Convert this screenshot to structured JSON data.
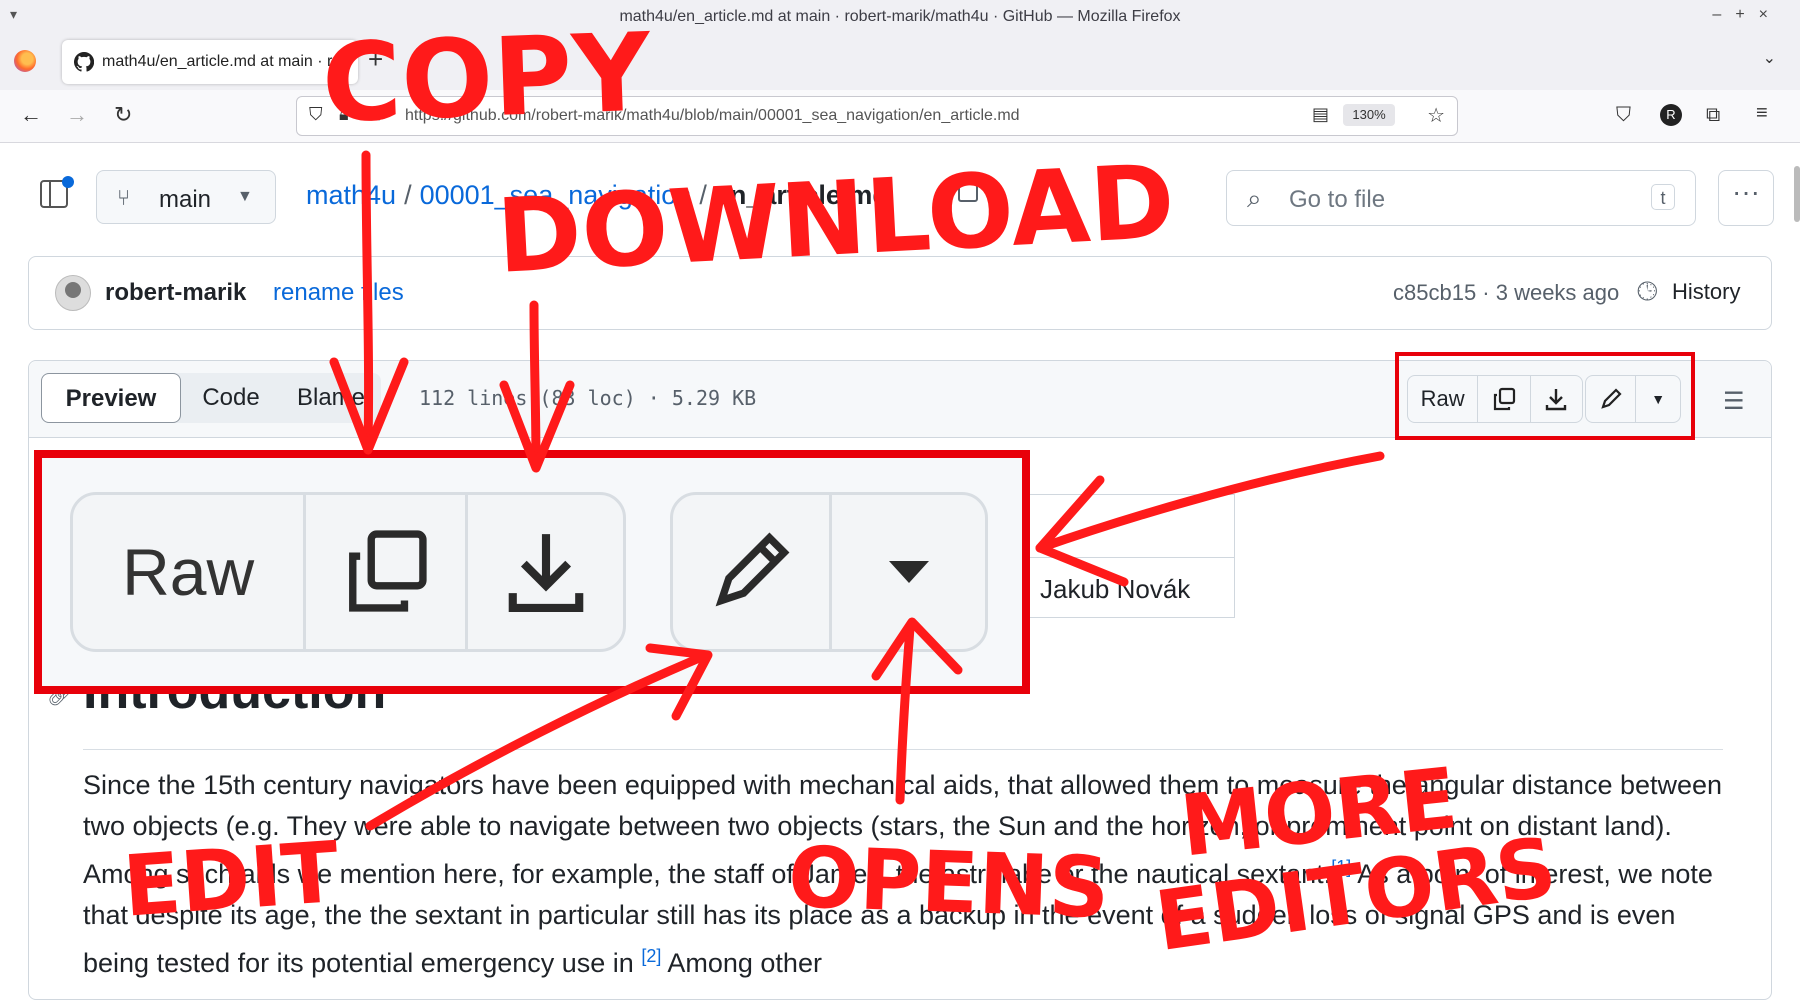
{
  "window": {
    "title": "math4u/en_article.md at main · robert-marik/math4u · GitHub — Mozilla Firefox",
    "menu_glyph": "▾",
    "controls": [
      "–",
      "+",
      "×"
    ]
  },
  "browser": {
    "tab_label": "math4u/en_article.md at main · robert-marik/math4u",
    "tab_close": "×",
    "new_tab": "+",
    "tab_list": "⌄",
    "url": "https://github.com/robert-marik/math4u/blob/main/00001_sea_navigation/en_article.md",
    "zoom": "130%",
    "profile_initial": "R"
  },
  "github": {
    "branch": "main",
    "breadcrumb": {
      "repo": "math4u",
      "folder": "00001_sea_navigation",
      "file": "en_article.md",
      "separator": "/"
    },
    "goto_file": {
      "placeholder": "Go to file",
      "shortcut": "t"
    },
    "more_glyph": "···",
    "commit": {
      "author": "robert-marik",
      "message": "rename files",
      "sha_age": "c85cb15 · 3 weeks ago",
      "history_label": "History"
    },
    "file_view": {
      "tabs": [
        "Preview",
        "Code",
        "Blame"
      ],
      "active_tab": "Preview",
      "info": "112 lines (83 loc) · 5.29 KB",
      "raw_label": "Raw"
    },
    "content": {
      "table_cell": "Jakub Novák",
      "heading": "Introduction",
      "paragraph_1": "Since the 15th century navigators have been equipped with mechanical aids, that allowed them to measure the angular distance between two objects (e.g. They were able to navigate between two objects (stars, the Sun and the horizon, or prominent point on distant land). Among such aids we mention here, for example, the staff of James, the astrolabe or the nautical sextant.",
      "footnote_1": "[1]",
      "paragraph_2": " As a point of interest, we note that despite its age, the the sextant in particular still has its place as a backup in the event of a sudden loss of signal GPS and is even being tested for its potential emergency use in ",
      "footnote_2": "[2]",
      "paragraph_3": " Among other"
    }
  },
  "annotations": {
    "zoom_raw_label": "Raw",
    "copy": "COPY",
    "download": "DOWNLOAD",
    "edit": "EDIT",
    "opens": "OPENS",
    "more": "MORE",
    "editors": "EDITORS",
    "color": "#ff1a1a"
  }
}
